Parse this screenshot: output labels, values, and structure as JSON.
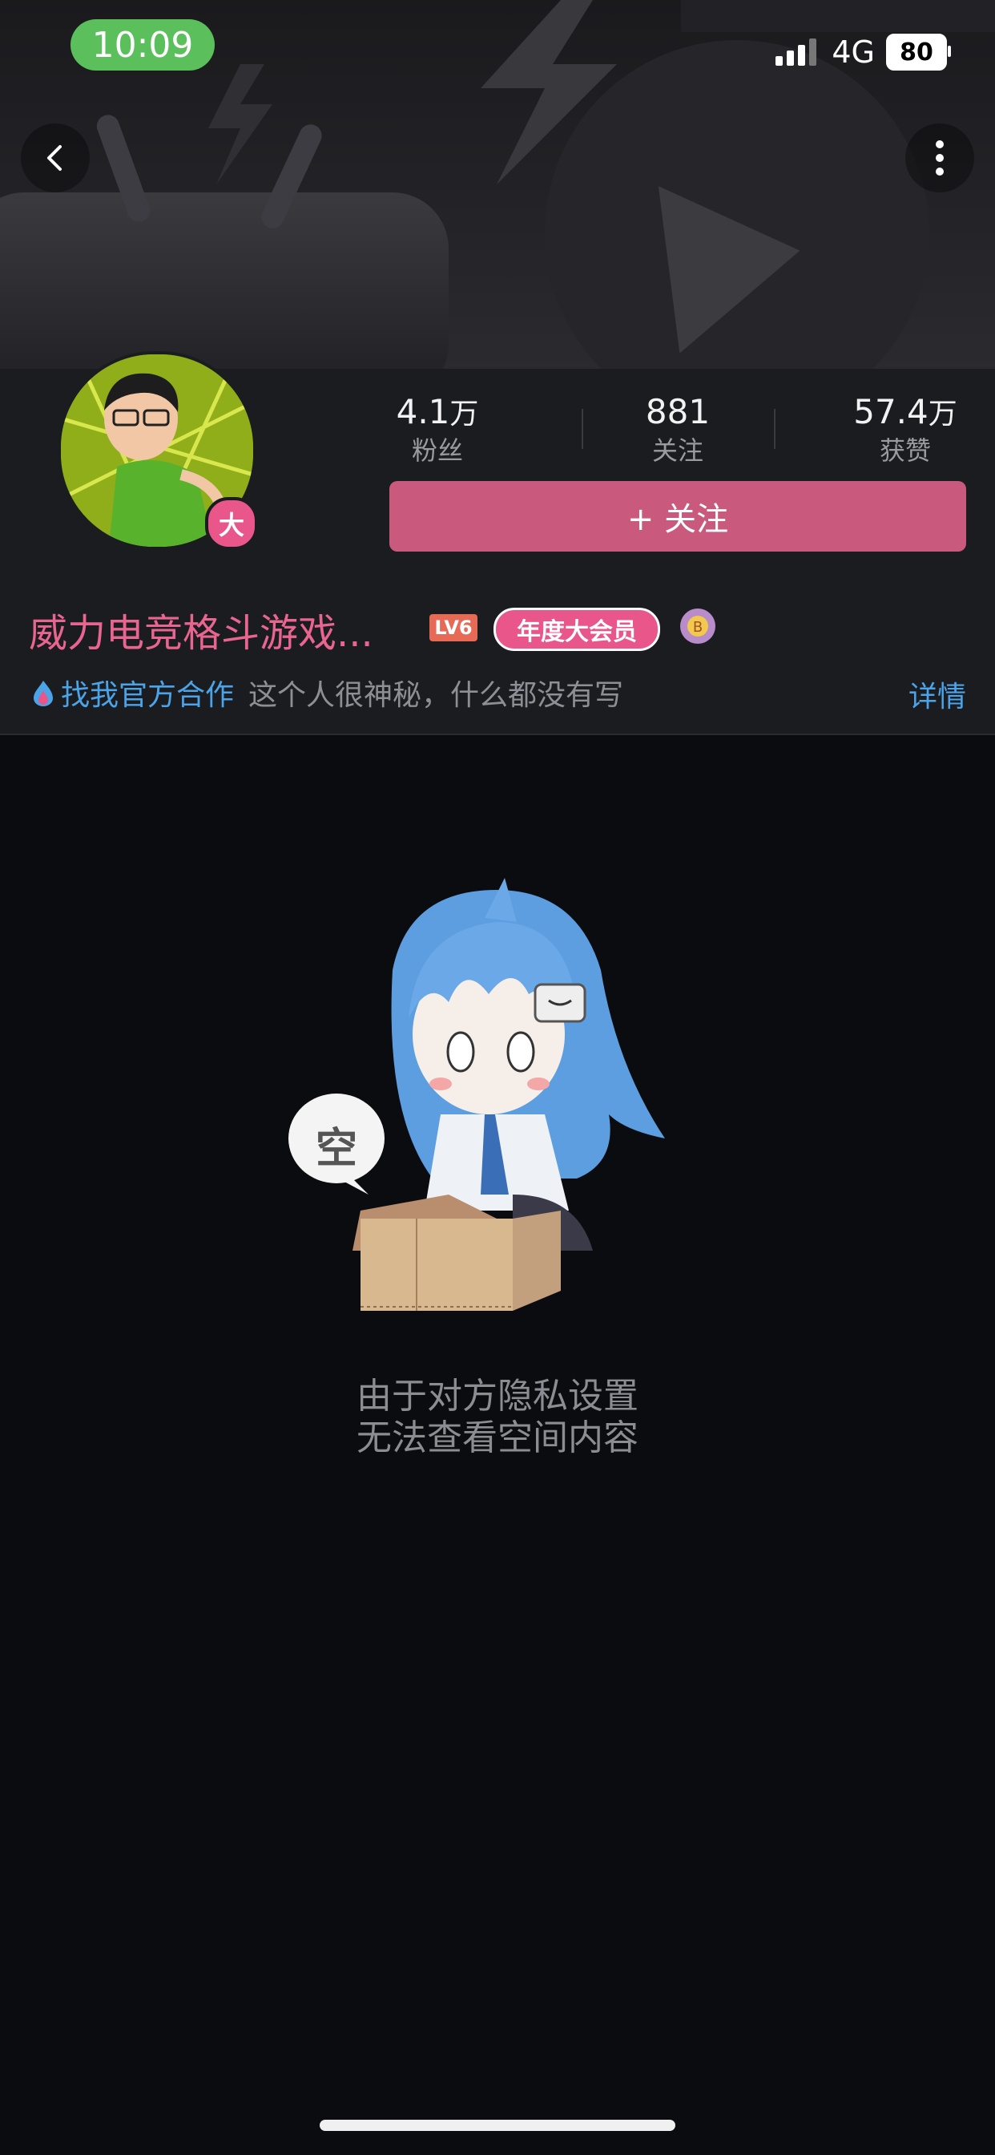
{
  "status_bar": {
    "time": "10:09",
    "network": "4G",
    "battery": "80"
  },
  "header": {
    "back": "back",
    "more": "more"
  },
  "profile": {
    "avatar_badge": "大",
    "stats": [
      {
        "value": "4.1",
        "unit": "万",
        "label": "粉丝"
      },
      {
        "value": "881",
        "unit": "",
        "label": "关注"
      },
      {
        "value": "57.4",
        "unit": "万",
        "label": "获赞"
      }
    ],
    "follow_button": "+ 关注",
    "name": "威力电竞格斗游戏...",
    "level": "LV6",
    "vip_badge": "年度大会员",
    "cooperation": "找我官方合作",
    "bio": "这个人很神秘，什么都没有写",
    "detail": "详情"
  },
  "empty_state": {
    "bubble": "空",
    "line1": "由于对方隐私设置",
    "line2": "无法查看空间内容"
  },
  "colors": {
    "accent": "#c95a7e",
    "link": "#4ba4e8",
    "name": "#e8658f",
    "vip": "#e8568a"
  }
}
